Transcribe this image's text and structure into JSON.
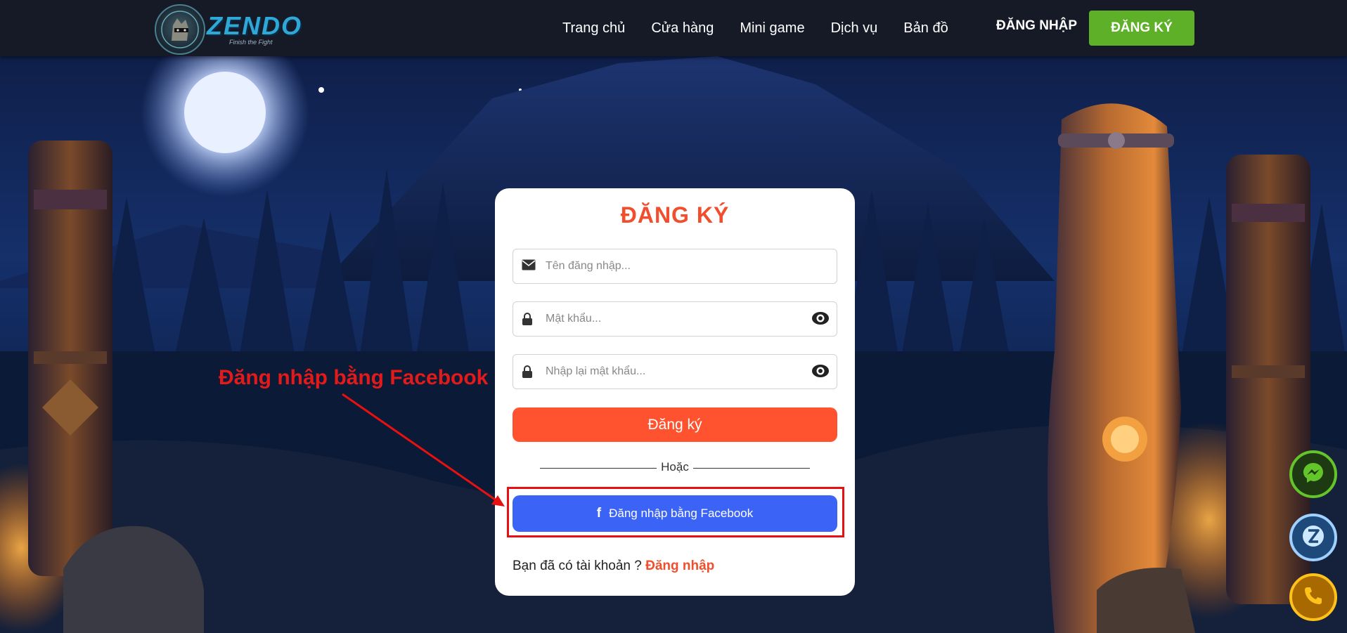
{
  "header": {
    "logo_text": "ZENDO",
    "logo_tagline": "Finish the Fight",
    "nav": [
      "Trang chủ",
      "Cửa hàng",
      "Mini game",
      "Dịch vụ",
      "Bản đồ"
    ],
    "login_label": "ĐĂNG NHẬP",
    "register_label": "ĐĂNG KÝ"
  },
  "form": {
    "title": "ĐĂNG KÝ",
    "username_placeholder": "Tên đăng nhập...",
    "password_placeholder": "Mật khẩu...",
    "confirm_placeholder": "Nhập lại mật khẩu...",
    "submit_label": "Đăng ký",
    "divider_label": "Hoặc",
    "facebook_label": "Đăng nhập bằng Facebook",
    "have_account_text": "Bạn đã có tài khoản ?",
    "login_link_label": "Đăng nhập"
  },
  "annotation": {
    "text": "Đăng nhập bằng Facebook"
  },
  "colors": {
    "accent": "#f04e2c",
    "register_green": "#5db027",
    "facebook_blue": "#3b64f6",
    "annotation_red": "#e21a1a"
  },
  "icons": [
    "envelope-icon",
    "lock-icon",
    "eye-icon",
    "facebook-icon",
    "messenger-icon",
    "zalo-icon",
    "phone-icon"
  ]
}
